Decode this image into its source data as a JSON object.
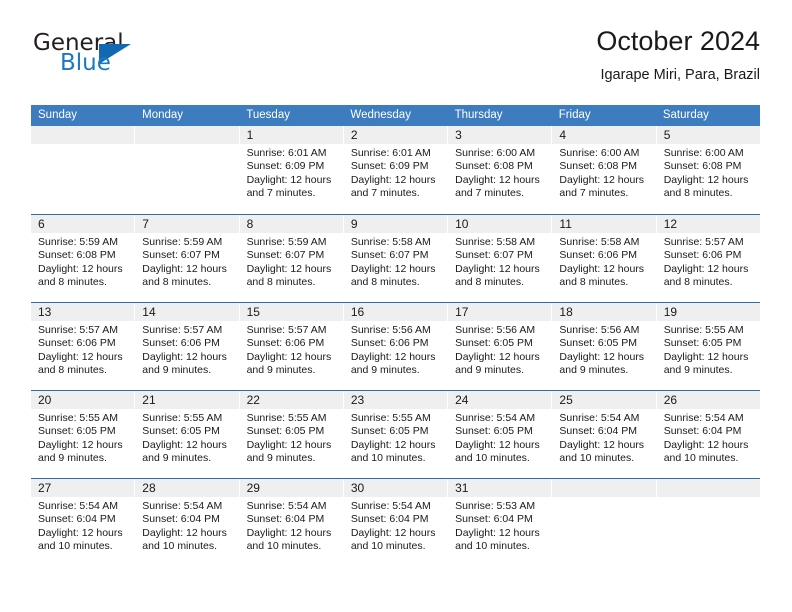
{
  "brand": {
    "word_general": "General",
    "word_blue": "Blue",
    "triangle_color": "#1268b3",
    "blue_color": "#1b79c4"
  },
  "header": {
    "title": "October 2024",
    "subtitle": "Igarape Miri, Para, Brazil"
  },
  "theme": {
    "header_bar": "#3c7cbf",
    "row_separator": "#2f6fb0",
    "day_band": "#efefef"
  },
  "weekdays": [
    "Sunday",
    "Monday",
    "Tuesday",
    "Wednesday",
    "Thursday",
    "Friday",
    "Saturday"
  ],
  "weeks": [
    [
      {
        "day": "",
        "lines": []
      },
      {
        "day": "",
        "lines": []
      },
      {
        "day": "1",
        "lines": [
          "Sunrise: 6:01 AM",
          "Sunset: 6:09 PM",
          "Daylight: 12 hours",
          "and 7 minutes."
        ]
      },
      {
        "day": "2",
        "lines": [
          "Sunrise: 6:01 AM",
          "Sunset: 6:09 PM",
          "Daylight: 12 hours",
          "and 7 minutes."
        ]
      },
      {
        "day": "3",
        "lines": [
          "Sunrise: 6:00 AM",
          "Sunset: 6:08 PM",
          "Daylight: 12 hours",
          "and 7 minutes."
        ]
      },
      {
        "day": "4",
        "lines": [
          "Sunrise: 6:00 AM",
          "Sunset: 6:08 PM",
          "Daylight: 12 hours",
          "and 7 minutes."
        ]
      },
      {
        "day": "5",
        "lines": [
          "Sunrise: 6:00 AM",
          "Sunset: 6:08 PM",
          "Daylight: 12 hours",
          "and 8 minutes."
        ]
      }
    ],
    [
      {
        "day": "6",
        "lines": [
          "Sunrise: 5:59 AM",
          "Sunset: 6:08 PM",
          "Daylight: 12 hours",
          "and 8 minutes."
        ]
      },
      {
        "day": "7",
        "lines": [
          "Sunrise: 5:59 AM",
          "Sunset: 6:07 PM",
          "Daylight: 12 hours",
          "and 8 minutes."
        ]
      },
      {
        "day": "8",
        "lines": [
          "Sunrise: 5:59 AM",
          "Sunset: 6:07 PM",
          "Daylight: 12 hours",
          "and 8 minutes."
        ]
      },
      {
        "day": "9",
        "lines": [
          "Sunrise: 5:58 AM",
          "Sunset: 6:07 PM",
          "Daylight: 12 hours",
          "and 8 minutes."
        ]
      },
      {
        "day": "10",
        "lines": [
          "Sunrise: 5:58 AM",
          "Sunset: 6:07 PM",
          "Daylight: 12 hours",
          "and 8 minutes."
        ]
      },
      {
        "day": "11",
        "lines": [
          "Sunrise: 5:58 AM",
          "Sunset: 6:06 PM",
          "Daylight: 12 hours",
          "and 8 minutes."
        ]
      },
      {
        "day": "12",
        "lines": [
          "Sunrise: 5:57 AM",
          "Sunset: 6:06 PM",
          "Daylight: 12 hours",
          "and 8 minutes."
        ]
      }
    ],
    [
      {
        "day": "13",
        "lines": [
          "Sunrise: 5:57 AM",
          "Sunset: 6:06 PM",
          "Daylight: 12 hours",
          "and 8 minutes."
        ]
      },
      {
        "day": "14",
        "lines": [
          "Sunrise: 5:57 AM",
          "Sunset: 6:06 PM",
          "Daylight: 12 hours",
          "and 9 minutes."
        ]
      },
      {
        "day": "15",
        "lines": [
          "Sunrise: 5:57 AM",
          "Sunset: 6:06 PM",
          "Daylight: 12 hours",
          "and 9 minutes."
        ]
      },
      {
        "day": "16",
        "lines": [
          "Sunrise: 5:56 AM",
          "Sunset: 6:06 PM",
          "Daylight: 12 hours",
          "and 9 minutes."
        ]
      },
      {
        "day": "17",
        "lines": [
          "Sunrise: 5:56 AM",
          "Sunset: 6:05 PM",
          "Daylight: 12 hours",
          "and 9 minutes."
        ]
      },
      {
        "day": "18",
        "lines": [
          "Sunrise: 5:56 AM",
          "Sunset: 6:05 PM",
          "Daylight: 12 hours",
          "and 9 minutes."
        ]
      },
      {
        "day": "19",
        "lines": [
          "Sunrise: 5:55 AM",
          "Sunset: 6:05 PM",
          "Daylight: 12 hours",
          "and 9 minutes."
        ]
      }
    ],
    [
      {
        "day": "20",
        "lines": [
          "Sunrise: 5:55 AM",
          "Sunset: 6:05 PM",
          "Daylight: 12 hours",
          "and 9 minutes."
        ]
      },
      {
        "day": "21",
        "lines": [
          "Sunrise: 5:55 AM",
          "Sunset: 6:05 PM",
          "Daylight: 12 hours",
          "and 9 minutes."
        ]
      },
      {
        "day": "22",
        "lines": [
          "Sunrise: 5:55 AM",
          "Sunset: 6:05 PM",
          "Daylight: 12 hours",
          "and 9 minutes."
        ]
      },
      {
        "day": "23",
        "lines": [
          "Sunrise: 5:55 AM",
          "Sunset: 6:05 PM",
          "Daylight: 12 hours",
          "and 10 minutes."
        ]
      },
      {
        "day": "24",
        "lines": [
          "Sunrise: 5:54 AM",
          "Sunset: 6:05 PM",
          "Daylight: 12 hours",
          "and 10 minutes."
        ]
      },
      {
        "day": "25",
        "lines": [
          "Sunrise: 5:54 AM",
          "Sunset: 6:04 PM",
          "Daylight: 12 hours",
          "and 10 minutes."
        ]
      },
      {
        "day": "26",
        "lines": [
          "Sunrise: 5:54 AM",
          "Sunset: 6:04 PM",
          "Daylight: 12 hours",
          "and 10 minutes."
        ]
      }
    ],
    [
      {
        "day": "27",
        "lines": [
          "Sunrise: 5:54 AM",
          "Sunset: 6:04 PM",
          "Daylight: 12 hours",
          "and 10 minutes."
        ]
      },
      {
        "day": "28",
        "lines": [
          "Sunrise: 5:54 AM",
          "Sunset: 6:04 PM",
          "Daylight: 12 hours",
          "and 10 minutes."
        ]
      },
      {
        "day": "29",
        "lines": [
          "Sunrise: 5:54 AM",
          "Sunset: 6:04 PM",
          "Daylight: 12 hours",
          "and 10 minutes."
        ]
      },
      {
        "day": "30",
        "lines": [
          "Sunrise: 5:54 AM",
          "Sunset: 6:04 PM",
          "Daylight: 12 hours",
          "and 10 minutes."
        ]
      },
      {
        "day": "31",
        "lines": [
          "Sunrise: 5:53 AM",
          "Sunset: 6:04 PM",
          "Daylight: 12 hours",
          "and 10 minutes."
        ]
      },
      {
        "day": "",
        "lines": []
      },
      {
        "day": "",
        "lines": []
      }
    ]
  ]
}
